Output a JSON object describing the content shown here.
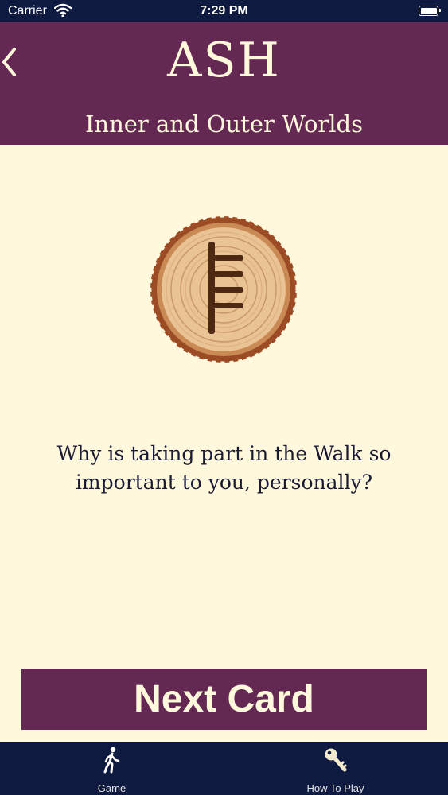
{
  "status_bar": {
    "carrier": "Carrier",
    "time": "7:29 PM"
  },
  "header": {
    "app_title": "ASH",
    "card_title": "Inner and Outer Worlds"
  },
  "card": {
    "ogham_icon": "ogham-ash-rune-icon",
    "question": "Why is taking part in the Walk so important to you, personally?"
  },
  "actions": {
    "next_label": "Next Card"
  },
  "tab_bar": {
    "tabs": [
      {
        "label": "Game",
        "icon": "walking-person-icon"
      },
      {
        "label": "How To Play",
        "icon": "key-icon"
      }
    ]
  },
  "colors": {
    "header_bg": "#632952",
    "page_bg": "#fff8dd",
    "tab_bar_bg": "#0e1a3f"
  }
}
